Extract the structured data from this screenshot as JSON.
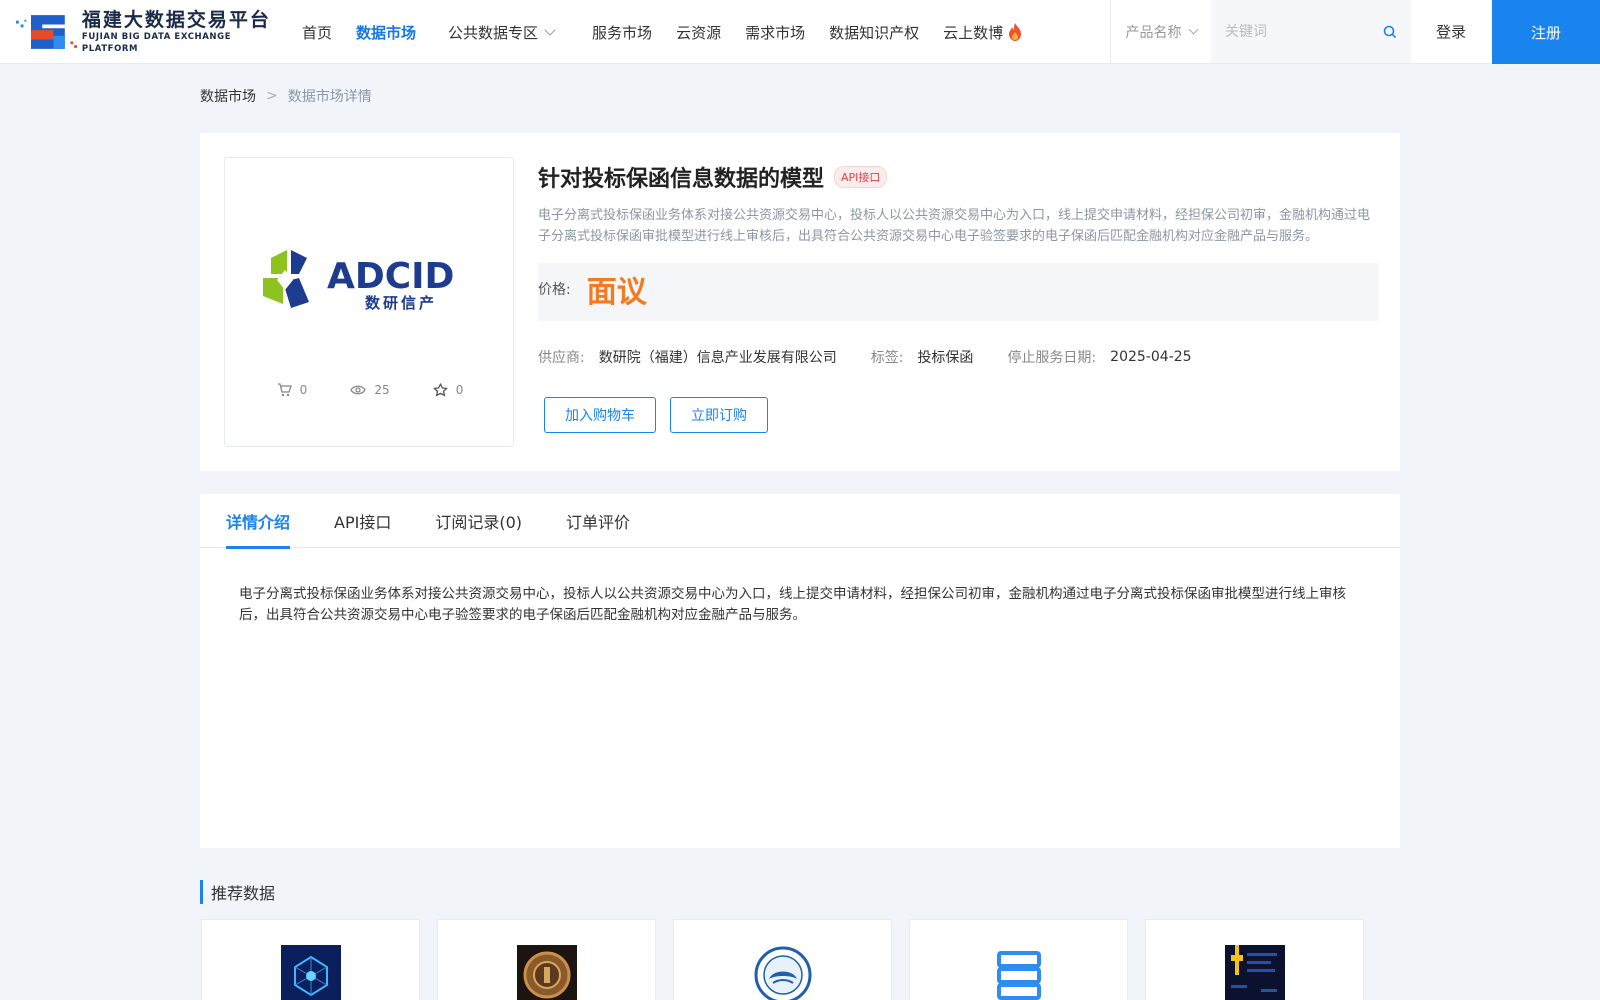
{
  "header": {
    "logo_cn": "福建大数据交易平台",
    "logo_en": "FUJIAN BIG DATA EXCHANGE  PLATFORM",
    "nav": [
      {
        "label": "首页",
        "active": false
      },
      {
        "label": "数据市场",
        "active": true
      },
      {
        "label": "公共数据专区",
        "active": false,
        "dropdown": true
      },
      {
        "label": "服务市场",
        "active": false
      },
      {
        "label": "云资源",
        "active": false
      },
      {
        "label": "需求市场",
        "active": false
      },
      {
        "label": "数据知识产权",
        "active": false
      },
      {
        "label": "云上数博",
        "active": false,
        "icon": "flame-icon"
      }
    ],
    "search_type": "产品名称",
    "search_placeholder": "关键词",
    "login": "登录",
    "register": "注册"
  },
  "breadcrumb": {
    "items": [
      "数据市场",
      "数据市场详情"
    ],
    "separator": ">"
  },
  "product": {
    "title": "针对投标保函信息数据的模型",
    "badge": "API接口",
    "logo_text": "ADCID",
    "logo_subtext": "数研信产",
    "description": "电子分离式投标保函业务体系对接公共资源交易中心，投标人以公共资源交易中心为入口，线上提交申请材料，经担保公司初审，金融机构通过电子分离式投标保函审批模型进行线上审核后，出具符合公共资源交易中心电子验签要求的电子保函后匹配金融机构对应金融产品与服务。",
    "price_label": "价格:",
    "price_value": "面议",
    "supplier_label": "供应商:",
    "supplier": "数研院（福建）信息产业发展有限公司",
    "tag_label": "标签:",
    "tag": "投标保函",
    "stop_date_label": "停止服务日期:",
    "stop_date": "2025-04-25",
    "stats": {
      "cart_count": "0",
      "view_count": "25",
      "favorite_count": "0"
    },
    "add_to_cart": "加入购物车",
    "subscribe": "立即订购"
  },
  "tabs": [
    {
      "label": "详情介绍",
      "active": true
    },
    {
      "label": "API接口",
      "active": false
    },
    {
      "label": "订阅记录(0)",
      "active": false
    },
    {
      "label": "订单评价",
      "active": false
    }
  ],
  "detail_text": "电子分离式投标保函业务体系对接公共资源交易中心，投标人以公共资源交易中心为入口，线上提交申请材料，经担保公司初审，金融机构通过电子分离式投标保函审批模型进行线上审核后，出具符合公共资源交易中心电子验签要求的电子保函后匹配金融机构对应金融产品与服务。",
  "recommend": {
    "title": "推荐数据",
    "cards": [
      {
        "thumb": "blue-cube-image"
      },
      {
        "thumb": "bronze-coin-image"
      },
      {
        "thumb": "weather-seal-image"
      },
      {
        "thumb": "server-icon"
      },
      {
        "thumb": "dark-code-image"
      }
    ]
  },
  "colors": {
    "brand": "#1a84ee",
    "price": "#f47a1f",
    "badge": "#e5414a"
  }
}
